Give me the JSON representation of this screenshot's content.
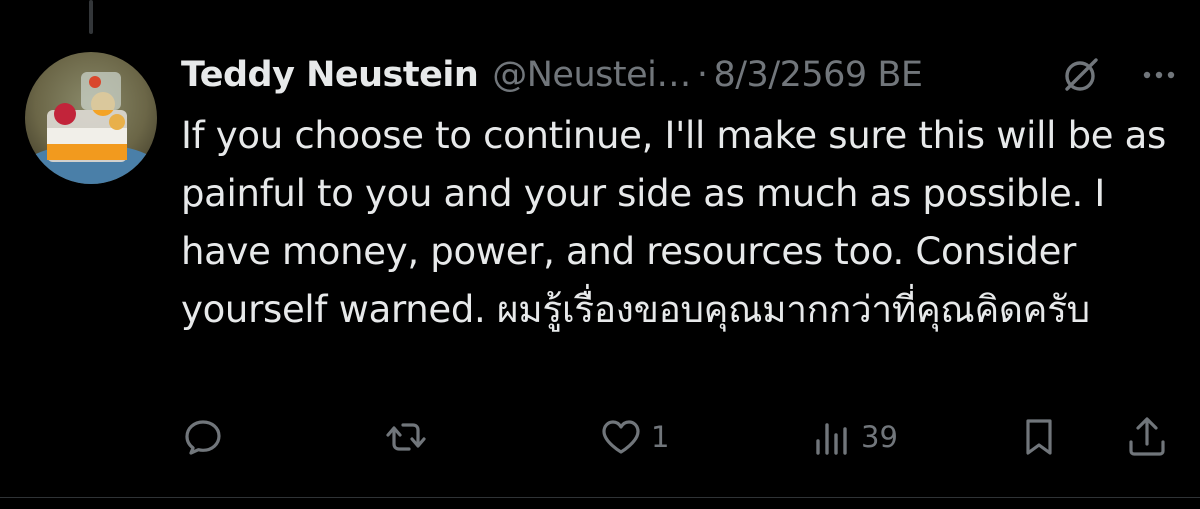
{
  "tweet": {
    "author_name": "Teddy Neustein",
    "handle": "@Neustei…",
    "separator": "·",
    "date": "8/3/2569 BE",
    "text": "If you choose to continue, I'll make sure this will be as painful to you and your side as much as possible. I have money, power, and resources too. Consider yourself warned. ผมรู้เรื่องขอบคุณมากกว่าที่คุณคิดครับ",
    "avatar_icon": "avatar-photo"
  },
  "header_icons": {
    "grok": "grok-icon",
    "more": "more-icon"
  },
  "actions": {
    "reply": {
      "icon": "reply-icon",
      "count": ""
    },
    "repost": {
      "icon": "repost-icon",
      "count": ""
    },
    "like": {
      "icon": "heart-icon",
      "count": "1"
    },
    "views": {
      "icon": "views-icon",
      "count": "39"
    },
    "bookmark": {
      "icon": "bookmark-icon",
      "count": ""
    },
    "share": {
      "icon": "share-icon",
      "count": ""
    }
  },
  "colors": {
    "background": "#000000",
    "primary_text": "#e7e9ea",
    "secondary_text": "#71767b",
    "divider": "#2f3336"
  }
}
